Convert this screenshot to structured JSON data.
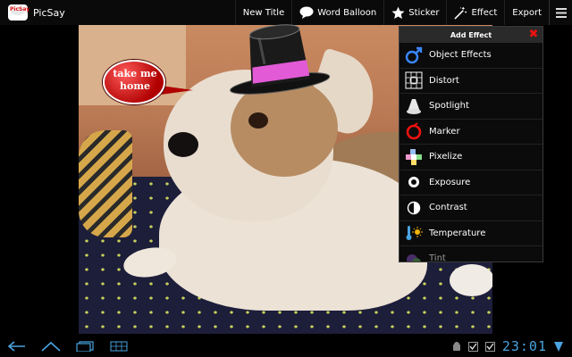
{
  "app": {
    "name": "PicSay",
    "logo_text": "PicSay"
  },
  "toolbar": {
    "actions": [
      {
        "label": "New Title",
        "icon": "title-icon"
      },
      {
        "label": "Word Balloon",
        "icon": "speech-bubble-icon"
      },
      {
        "label": "Sticker",
        "icon": "star-icon"
      },
      {
        "label": "Effect",
        "icon": "magic-wand-icon"
      },
      {
        "label": "Export",
        "icon": ""
      }
    ],
    "overflow_icon": "menu-icon"
  },
  "canvas": {
    "balloon_text": "take me home"
  },
  "effect_panel": {
    "title": "Add Effect",
    "items": [
      {
        "label": "Object Effects",
        "icon": "male-symbol-icon",
        "color": "#3a86ff"
      },
      {
        "label": "Distort",
        "icon": "grid-distort-icon",
        "color": "#ffffff"
      },
      {
        "label": "Spotlight",
        "icon": "spotlight-icon",
        "color": "#ffffff"
      },
      {
        "label": "Marker",
        "icon": "marker-icon",
        "color": "#e11"
      },
      {
        "label": "Pixelize",
        "icon": "pixelize-icon",
        "color": "#ffffff"
      },
      {
        "label": "Exposure",
        "icon": "exposure-icon",
        "color": "#ffffff"
      },
      {
        "label": "Contrast",
        "icon": "contrast-icon",
        "color": "#ffffff"
      },
      {
        "label": "Temperature",
        "icon": "temperature-icon",
        "color": "#4aa3df"
      },
      {
        "label": "Tint",
        "icon": "tint-icon",
        "color": "#7b4bb5"
      }
    ]
  },
  "system_bar": {
    "clock": "23:01",
    "accent": "#4aa3df"
  }
}
